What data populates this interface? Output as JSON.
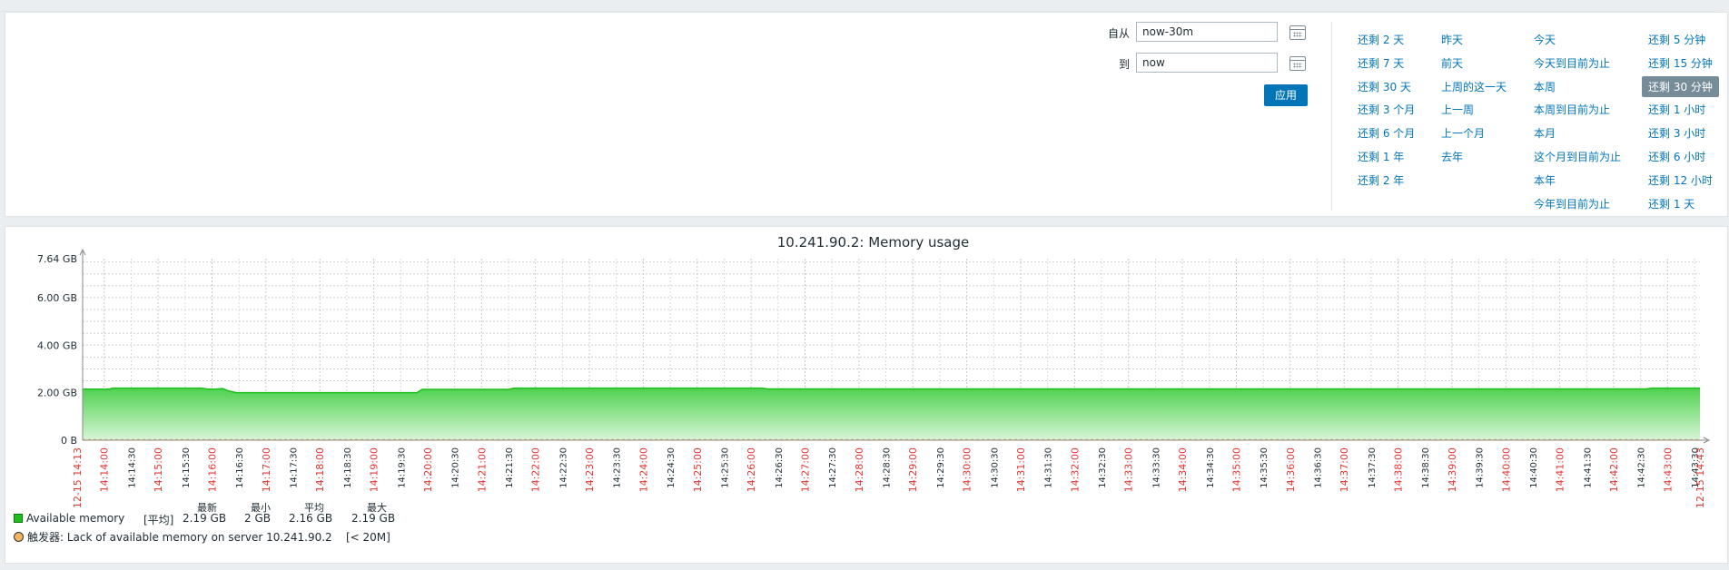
{
  "filter": {
    "from_label": "自从",
    "from_value": "now-30m",
    "to_label": "到",
    "to_value": "now",
    "apply_label": "应用",
    "quick_ranges": [
      [
        "还剩 2 天",
        "还剩 7 天",
        "还剩 30 天",
        "还剩 3 个月",
        "还剩 6 个月",
        "还剩 1 年",
        "还剩 2 年"
      ],
      [
        "昨天",
        "前天",
        "上周的这一天",
        "上一周",
        "上一个月",
        "去年"
      ],
      [
        "今天",
        "今天到目前为止",
        "本周",
        "本周到目前为止",
        "本月",
        "这个月到目前为止",
        "本年",
        "今年到目前为止"
      ],
      [
        "还剩 5 分钟",
        "还剩 15 分钟",
        "还剩 30 分钟",
        "还剩 1 小时",
        "还剩 3 小时",
        "还剩 6 小时",
        "还剩 12 小时",
        "还剩 1 天"
      ]
    ],
    "selected_range": "还剩 30 分钟"
  },
  "graph": {
    "title": "10.241.90.2: Memory usage",
    "legend": {
      "series_name": "Available memory",
      "func": "[平均]",
      "stat_headers": [
        "最新",
        "最小",
        "平均",
        "最大"
      ],
      "stat_values": [
        "2.19 GB",
        "2 GB",
        "2.16 GB",
        "2.19 GB"
      ],
      "trigger_prefix": "触发器:",
      "trigger_text": "Lack of available memory on server 10.241.90.2",
      "trigger_cond": "[< 20M]"
    }
  },
  "chart_data": {
    "type": "area",
    "title": "10.241.90.2: Memory usage",
    "ylim": [
      0,
      7.64
    ],
    "y_ticks": [
      {
        "value": 0,
        "label": "0 B"
      },
      {
        "value": 2,
        "label": "2.00 GB"
      },
      {
        "value": 4,
        "label": "4.00 GB"
      },
      {
        "value": 6,
        "label": "6.00 GB"
      },
      {
        "value": 7.64,
        "label": "7.64 GB"
      }
    ],
    "x_range_minutes": [
      0,
      30
    ],
    "x_tick_labels": [
      "14:14:00",
      "14:14:30",
      "14:15:00",
      "14:15:30",
      "14:16:00",
      "14:16:30",
      "14:17:00",
      "14:17:30",
      "14:18:00",
      "14:18:30",
      "14:19:00",
      "14:19:30",
      "14:20:00",
      "14:20:30",
      "14:21:00",
      "14:21:30",
      "14:22:00",
      "14:22:30",
      "14:23:00",
      "14:23:30",
      "14:24:00",
      "14:24:30",
      "14:25:00",
      "14:25:30",
      "14:26:00",
      "14:26:30",
      "14:27:00",
      "14:27:30",
      "14:28:00",
      "14:28:30",
      "14:29:00",
      "14:29:30",
      "14:30:00",
      "14:30:30",
      "14:31:00",
      "14:31:30",
      "14:32:00",
      "14:32:30",
      "14:33:00",
      "14:33:30",
      "14:34:00",
      "14:34:30",
      "14:35:00",
      "14:35:30",
      "14:36:00",
      "14:36:30",
      "14:37:00",
      "14:37:30",
      "14:38:00",
      "14:38:30",
      "14:39:00",
      "14:39:30",
      "14:40:00",
      "14:40:30",
      "14:41:00",
      "14:41:30",
      "14:42:00",
      "14:42:30",
      "14:43:00",
      "14:43:30"
    ],
    "x_start_label": "12-15 14:13",
    "x_end_label": "12-15 14:43",
    "series": [
      {
        "name": "Available memory",
        "color": "#1dbf1d",
        "x": [
          0,
          0.5,
          0.55,
          2.2,
          2.3,
          2.45,
          2.6,
          2.7,
          2.85,
          6.2,
          6.3,
          7.9,
          8.0,
          12.6,
          12.7,
          29.0,
          29.1,
          30
        ],
        "y": [
          2.15,
          2.15,
          2.19,
          2.19,
          2.16,
          2.15,
          2.17,
          2.08,
          2.0,
          2.0,
          2.14,
          2.14,
          2.19,
          2.19,
          2.16,
          2.16,
          2.19,
          2.19
        ]
      }
    ],
    "trigger_threshold_gb": 0.0195,
    "trigger_color": "#f5b461",
    "grid": true
  }
}
